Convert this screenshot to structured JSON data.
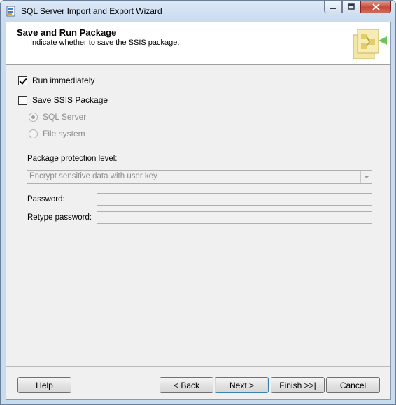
{
  "window": {
    "title": "SQL Server Import and Export Wizard"
  },
  "header": {
    "title": "Save and Run Package",
    "subtitle": "Indicate whether to save the SSIS package."
  },
  "options": {
    "run_immediately": {
      "label": "Run immediately",
      "checked": true
    },
    "save_ssis_package": {
      "label": "Save SSIS Package",
      "checked": false
    },
    "sql_server": {
      "label": "SQL Server",
      "selected": true,
      "enabled": false
    },
    "file_system": {
      "label": "File system",
      "selected": false,
      "enabled": false
    }
  },
  "protection": {
    "label": "Package protection level:",
    "value": "Encrypt sensitive data with user key"
  },
  "password": {
    "label": "Password:",
    "value": ""
  },
  "retype_password": {
    "label": "Retype password:",
    "value": ""
  },
  "buttons": {
    "help": "Help",
    "back": "< Back",
    "next": "Next >",
    "finish": "Finish >>|",
    "cancel": "Cancel"
  }
}
